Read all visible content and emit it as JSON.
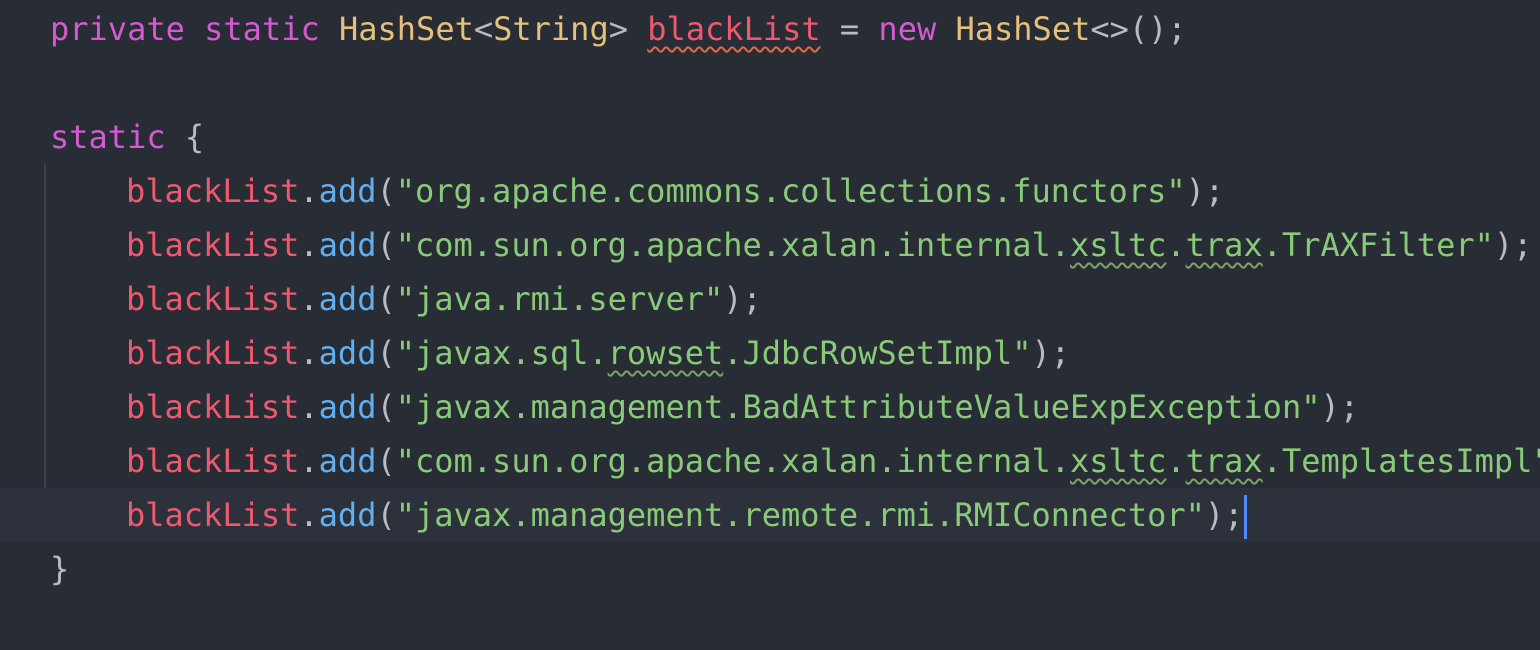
{
  "editor": {
    "language": "java",
    "theme_colors": {
      "background": "#282c34",
      "keyword": "#d45ad2",
      "type": "#e5c07b",
      "field": "#ef596f",
      "method": "#61afef",
      "string": "#89ca78",
      "caret": "#528bff"
    },
    "lines": {
      "decl": {
        "kw_private": "private",
        "kw_static": "static",
        "type_hashset": "HashSet",
        "lt": "<",
        "type_string": "String",
        "gt": ">",
        "field": "blackList",
        "assign": " = ",
        "kw_new": "new",
        "type_hashset2": "HashSet",
        "tail": "<>();"
      },
      "static_block": {
        "kw_static": "static",
        "open_brace": " {",
        "close_brace": "}"
      },
      "adds": {
        "field": "blackList",
        "dot": ".",
        "method": "add",
        "open": "(",
        "close": ");",
        "strings": [
          {
            "pre": "\"org.apache.commons.collections.functors\""
          },
          {
            "pre": "\"com.sun.org.apache.xalan.internal.",
            "t1": "xsltc",
            "mid": ".",
            "t2": "trax",
            "post": ".TrAXFilter\""
          },
          {
            "pre": "\"java.rmi.server\""
          },
          {
            "pre": "\"javax.sql.",
            "t1": "rowset",
            "post": ".JdbcRowSetImpl\""
          },
          {
            "pre": "\"javax.management.BadAttributeValueExpException\""
          },
          {
            "pre": "\"com.sun.org.apache.xalan.internal.",
            "t1": "xsltc",
            "mid": ".",
            "t2": "trax",
            "post": ".TemplatesImpl\""
          },
          {
            "pre": "\"javax.management.remote.rmi.RMIConnector\""
          }
        ]
      }
    }
  }
}
